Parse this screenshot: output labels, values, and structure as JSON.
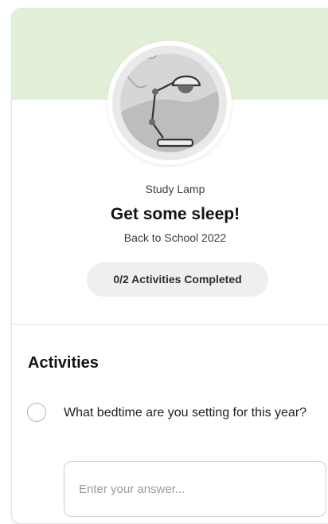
{
  "colors": {
    "banner": "#e3f0d8",
    "badge_ring": "#e9e9e9",
    "pill_background": "#efefef"
  },
  "badge": {
    "icon": "desk-lamp-icon",
    "subtitle": "Study Lamp"
  },
  "challenge": {
    "title": "Get some sleep!",
    "campaign": "Back to School 2022"
  },
  "progress": {
    "completed": 0,
    "total": 2,
    "label": "0/2 Activities Completed"
  },
  "activities": {
    "heading": "Activities",
    "items": [
      {
        "question": "What bedtime are you setting for this year?",
        "checked": false,
        "answer": {
          "value": "",
          "placeholder": "Enter your answer..."
        }
      }
    ]
  }
}
